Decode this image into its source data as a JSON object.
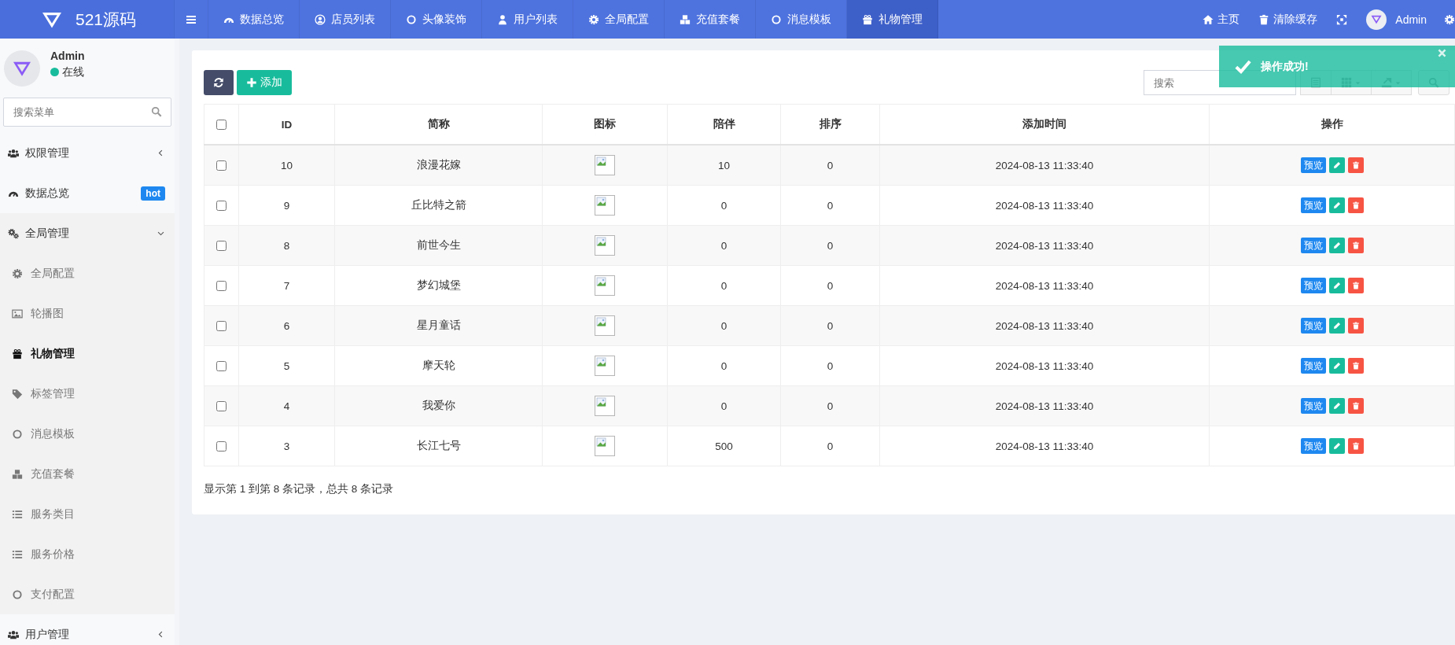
{
  "brand": {
    "name": "521源码"
  },
  "top_nav": [
    {
      "label": "数据总览",
      "selected": false
    },
    {
      "label": "店员列表",
      "selected": false
    },
    {
      "label": "头像装饰",
      "selected": false
    },
    {
      "label": "用户列表",
      "selected": false
    },
    {
      "label": "全局配置",
      "selected": false
    },
    {
      "label": "充值套餐",
      "selected": false
    },
    {
      "label": "消息模板",
      "selected": false
    },
    {
      "label": "礼物管理",
      "selected": true
    }
  ],
  "top_right": {
    "home": "主页",
    "clear_cache": "清除缓存",
    "user": "Admin"
  },
  "sidebar": {
    "user": {
      "name": "Admin",
      "status": "在线",
      "online": true
    },
    "search": {
      "placeholder": "搜索菜单"
    },
    "items": [
      {
        "kind": "group",
        "label": "权限管理",
        "expanded": false,
        "selected": false
      },
      {
        "kind": "link",
        "label": "数据总览",
        "badge": "hot",
        "selected": false
      },
      {
        "kind": "group",
        "label": "全局管理",
        "expanded": true,
        "selected": false,
        "children": [
          {
            "label": "全局配置",
            "selected": false
          },
          {
            "label": "轮播图",
            "selected": false
          },
          {
            "label": "礼物管理",
            "selected": true
          },
          {
            "label": "标签管理",
            "selected": false
          },
          {
            "label": "消息模板",
            "selected": false
          },
          {
            "label": "充值套餐",
            "selected": false
          },
          {
            "label": "服务类目",
            "selected": false
          },
          {
            "label": "服务价格",
            "selected": false
          },
          {
            "label": "支付配置",
            "selected": false
          }
        ]
      },
      {
        "kind": "group",
        "label": "用户管理",
        "expanded": false,
        "selected": false
      }
    ]
  },
  "toolbar": {
    "add_button": "添加",
    "search": {
      "placeholder": "搜索"
    }
  },
  "table": {
    "select_all_checked": false,
    "columns": [
      "ID",
      "简称",
      "图标",
      "陪伴",
      "排序",
      "添加时间",
      "操作"
    ],
    "rows": [
      {
        "checked": false,
        "id": "10",
        "name": "浪漫花嫁",
        "companion": "10",
        "sort": "0",
        "added": "2024-08-13 11:33:40",
        "preview": "预览"
      },
      {
        "checked": false,
        "id": "9",
        "name": "丘比特之箭",
        "companion": "0",
        "sort": "0",
        "added": "2024-08-13 11:33:40",
        "preview": "预览"
      },
      {
        "checked": false,
        "id": "8",
        "name": "前世今生",
        "companion": "0",
        "sort": "0",
        "added": "2024-08-13 11:33:40",
        "preview": "预览"
      },
      {
        "checked": false,
        "id": "7",
        "name": "梦幻城堡",
        "companion": "0",
        "sort": "0",
        "added": "2024-08-13 11:33:40",
        "preview": "预览"
      },
      {
        "checked": false,
        "id": "6",
        "name": "星月童话",
        "companion": "0",
        "sort": "0",
        "added": "2024-08-13 11:33:40",
        "preview": "预览"
      },
      {
        "checked": false,
        "id": "5",
        "name": "摩天轮",
        "companion": "0",
        "sort": "0",
        "added": "2024-08-13 11:33:40",
        "preview": "预览"
      },
      {
        "checked": false,
        "id": "4",
        "name": "我爱你",
        "companion": "0",
        "sort": "0",
        "added": "2024-08-13 11:33:40",
        "preview": "预览"
      },
      {
        "checked": false,
        "id": "3",
        "name": "长江七号",
        "companion": "500",
        "sort": "0",
        "added": "2024-08-13 11:33:40",
        "preview": "预览"
      }
    ]
  },
  "pagination": {
    "summary": "显示第 1 到第 8 条记录，总共 8 条记录"
  },
  "toast": {
    "message": "操作成功!"
  }
}
